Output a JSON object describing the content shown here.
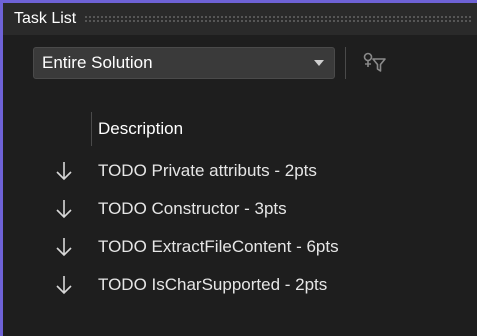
{
  "panel": {
    "title": "Task List"
  },
  "toolbar": {
    "scope_value": "Entire Solution",
    "filter_icon": "filter-icon"
  },
  "columns": {
    "description": "Description"
  },
  "tasks": [
    {
      "text": "TODO Private attributs - 2pts",
      "priority_icon": "low-priority-arrow-icon"
    },
    {
      "text": "TODO Constructor - 3pts",
      "priority_icon": "low-priority-arrow-icon"
    },
    {
      "text": "TODO ExtractFileContent - 6pts",
      "priority_icon": "low-priority-arrow-icon"
    },
    {
      "text": "TODO IsCharSupported - 2pts",
      "priority_icon": "low-priority-arrow-icon"
    }
  ],
  "colors": {
    "accent": "#6e62d6",
    "background": "#1e1e1e",
    "titlebar": "#2a2a2a",
    "dropdown": "#3a3a3a"
  }
}
